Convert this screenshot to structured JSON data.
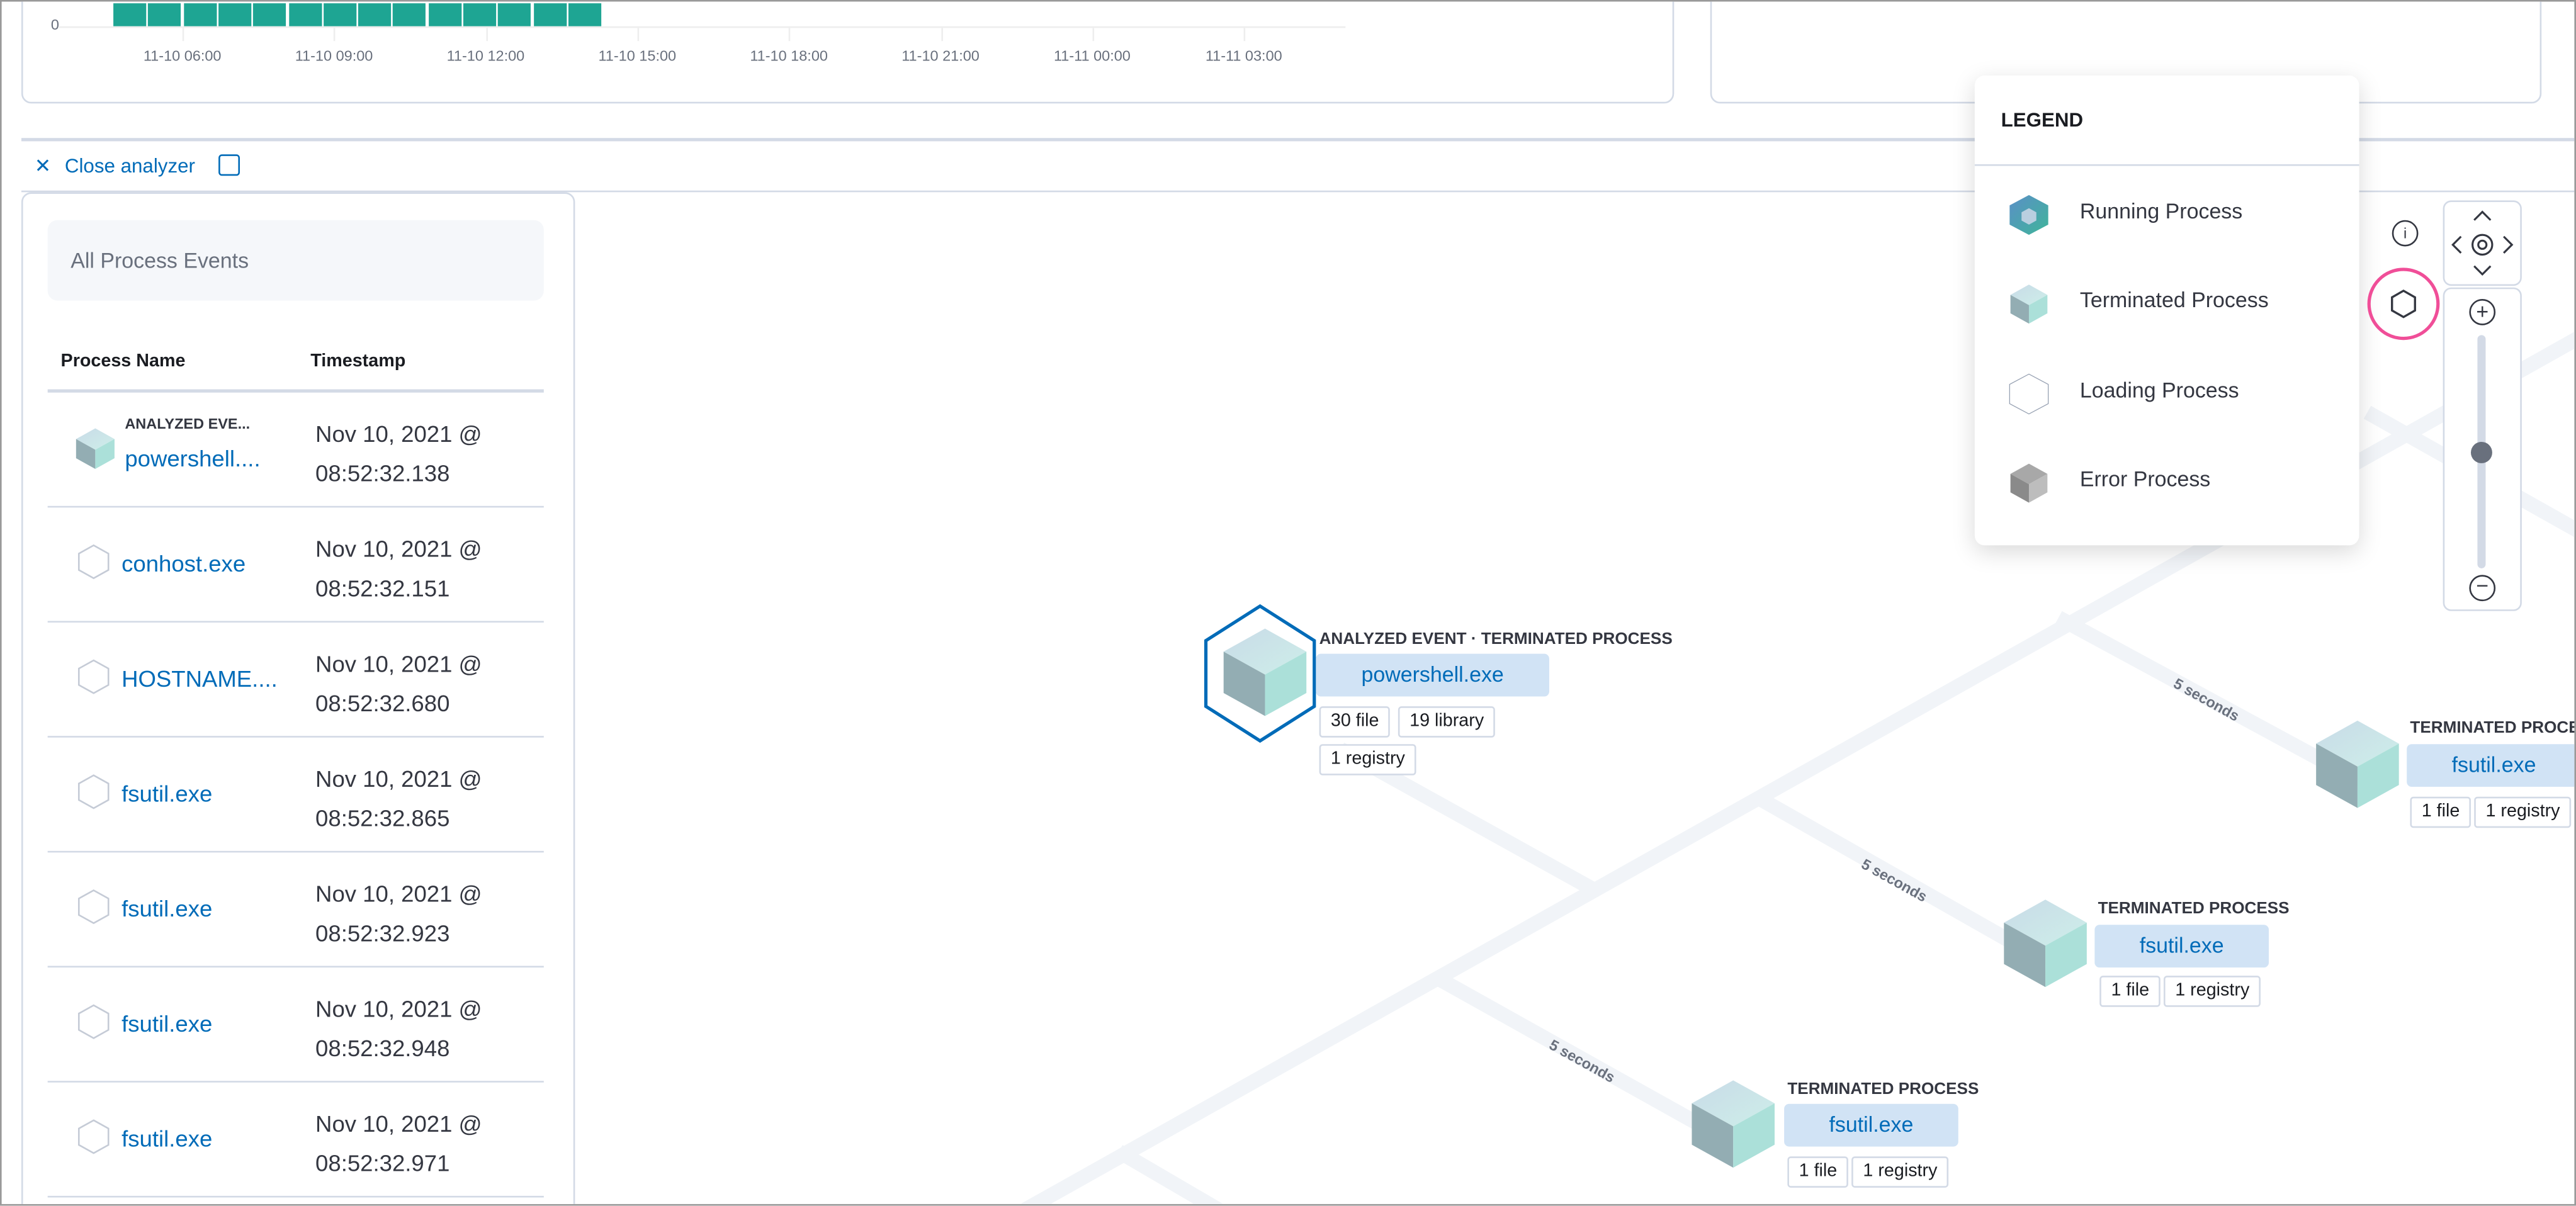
{
  "histogram": {
    "y_tick": "0",
    "x_ticks": [
      "11-10 06:00",
      "11-10 09:00",
      "11-10 12:00",
      "11-10 15:00",
      "11-10 18:00",
      "11-10 21:00",
      "11-11 00:00",
      "11-11 03:00"
    ],
    "bar_count": 14,
    "bar_color": "#1ea593"
  },
  "toolbar": {
    "close_label": "Close analyzer",
    "fullscreen_icon": "fullscreen-icon"
  },
  "side_panel": {
    "title": "All Process Events",
    "columns": [
      "Process Name",
      "Timestamp"
    ],
    "rows": [
      {
        "badge": "ANALYZED EVE...",
        "name": "powershell....",
        "date": "Nov 10, 2021 @",
        "time": "08:52:32.138",
        "icon": "terminated-process-selected"
      },
      {
        "name": "conhost.exe",
        "date": "Nov 10, 2021 @",
        "time": "08:52:32.151",
        "icon": "loading-process"
      },
      {
        "name": "HOSTNAME....",
        "date": "Nov 10, 2021 @",
        "time": "08:52:32.680",
        "icon": "loading-process"
      },
      {
        "name": "fsutil.exe",
        "date": "Nov 10, 2021 @",
        "time": "08:52:32.865",
        "icon": "loading-process"
      },
      {
        "name": "fsutil.exe",
        "date": "Nov 10, 2021 @",
        "time": "08:52:32.923",
        "icon": "loading-process"
      },
      {
        "name": "fsutil.exe",
        "date": "Nov 10, 2021 @",
        "time": "08:52:32.948",
        "icon": "loading-process"
      },
      {
        "name": "fsutil.exe",
        "date": "Nov 10, 2021 @",
        "time": "08:52:32.971",
        "icon": "loading-process"
      }
    ]
  },
  "graph": {
    "nodes": [
      {
        "label": "ANALYZED EVENT · TERMINATED PROCESS",
        "name": "powershell.exe",
        "chips": [
          "30 file",
          "19 library",
          "1 registry"
        ]
      },
      {
        "label": "TERMINATED PROCESS",
        "name": "fsutil.exe",
        "chips": [
          "1 file",
          "1 registry"
        ]
      },
      {
        "label": "TERMINATED PROCESS",
        "name": "fsutil.exe",
        "chips": [
          "1 file",
          "1 registry"
        ]
      },
      {
        "label": "TERMINATED PROCESS",
        "name": "fsutil.exe",
        "chips": [
          "1 file",
          "1 registry"
        ]
      }
    ],
    "edge_labels": [
      "5 seconds",
      "5 seconds",
      "5 seconds"
    ]
  },
  "legend": {
    "title": "LEGEND",
    "items": [
      "Running Process",
      "Terminated Process",
      "Loading Process",
      "Error Process"
    ]
  },
  "controls": {
    "zoom_level": 0.5,
    "highlight_color": "#f04e98"
  }
}
